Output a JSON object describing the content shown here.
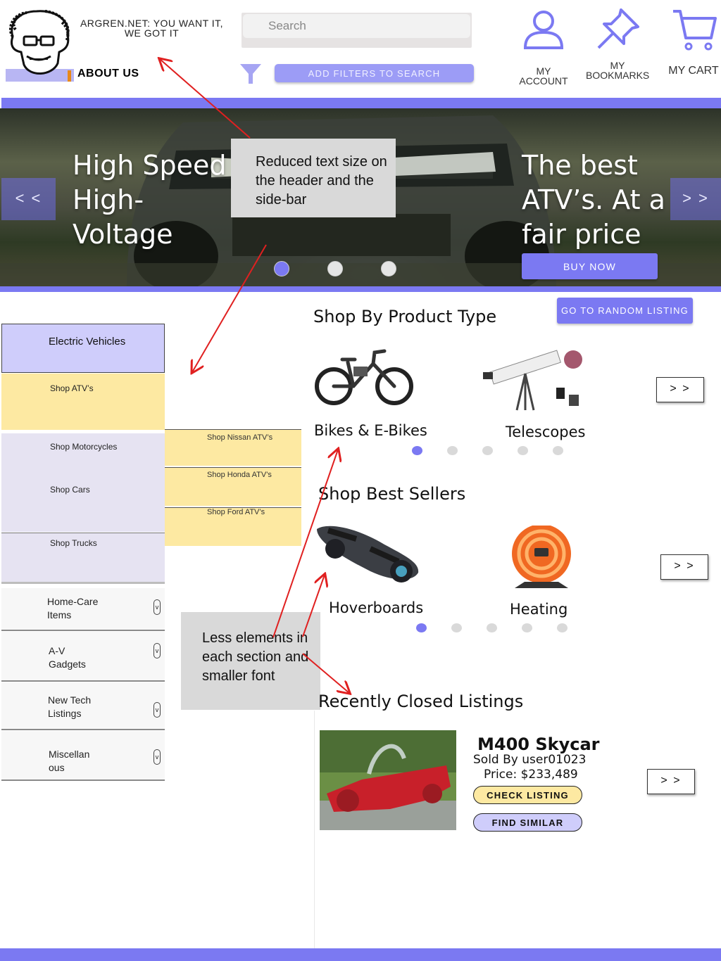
{
  "header": {
    "site_title": "ARGREN.NET: YOU WANT IT, WE GOT IT",
    "about_label": "ABOUT US",
    "search_placeholder": "Search",
    "add_filters_label": "ADD FILTERS TO SEARCH",
    "account_label": "MY ACCOUNT",
    "bookmarks_label": "MY BOOKMARKS",
    "cart_label": "MY CART"
  },
  "hero": {
    "left_text": "High Speed High-Voltage",
    "right_text": "The best ATV’s. At a fair price",
    "prev_label": "< <",
    "next_label": "> >",
    "buy_label": "BUY NOW",
    "active_slide": 1,
    "slide_count": 3
  },
  "annotations": {
    "note1": "Reduced text size on the header and the side-bar",
    "note2": "Less elements in each section and smaller font"
  },
  "sidebar": {
    "active_category": "Electric Vehicles",
    "ev_items": [
      "Shop ATV’s",
      "Shop Motorcycles",
      "Shop Cars",
      "Shop Trucks"
    ],
    "atv_items": [
      "Shop Nissan ATV’s",
      "Shop Honda ATV’s",
      "Shop Ford ATV’s"
    ],
    "categories": [
      "Home-Care Items",
      "A-V Gadgets",
      "New Tech Listings",
      "Miscellan ous"
    ],
    "chevron": "v"
  },
  "main": {
    "random_label": "GO TO RANDOM LISTING",
    "product_type_title": "Shop By Product Type",
    "product_types": [
      "Bikes & E-Bikes",
      "Telescopes"
    ],
    "best_sellers_title": "Shop Best Sellers",
    "best_sellers": [
      "Hoverboards",
      "Heating"
    ],
    "next_label": "> >",
    "carousel_dots": 5,
    "active_dot": 1,
    "recent_title": "Recently Closed Listings",
    "listing": {
      "name": "M400 Skycar",
      "seller": "Sold By user01023",
      "price": "Price: $233,489",
      "check_label": "CHECK LISTING",
      "similar_label": "FIND SIMILAR"
    }
  },
  "colors": {
    "accent": "#7b79f2",
    "accent_light": "#9c9cf6",
    "yellow": "#fde9a2",
    "lilac": "#cfcdfb",
    "annotation_arrow": "#e02020"
  }
}
